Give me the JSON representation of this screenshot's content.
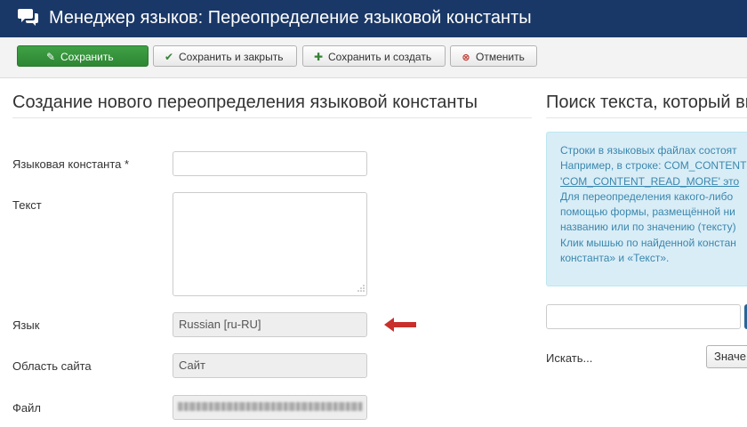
{
  "header": {
    "title": "Менеджер языков: Переопределение языковой константы",
    "background": "#1a3867"
  },
  "toolbar": {
    "save_label": "Сохранить",
    "save_close_label": "Сохранить и закрыть",
    "save_new_label": "Сохранить и создать",
    "cancel_label": "Отменить",
    "save_color": "#2f8a35"
  },
  "form": {
    "heading": "Создание нового переопределения языковой константы",
    "constant_label": "Языковая константа *",
    "constant_value": "",
    "text_label": "Текст",
    "text_value": "",
    "language_label": "Язык",
    "language_value": "Russian [ru-RU]",
    "client_label": "Область сайта",
    "client_value": "Сайт",
    "file_label": "Файл"
  },
  "search": {
    "heading": "Поиск текста, который вы",
    "info_lines": [
      "Строки в языковых файлах состоят",
      "Например, в строке: COM_CONTENT",
      "'COM_CONTENT_READ_MORE' это",
      "Для переопределения какого-либо",
      "помощью формы, размещённой ни",
      "названию или по значению (тексту)",
      "Клик мышью по найденной констан",
      "константа» и «Текст»."
    ],
    "input_value": "",
    "search_label": "Искать...",
    "type_option": "Значе"
  }
}
